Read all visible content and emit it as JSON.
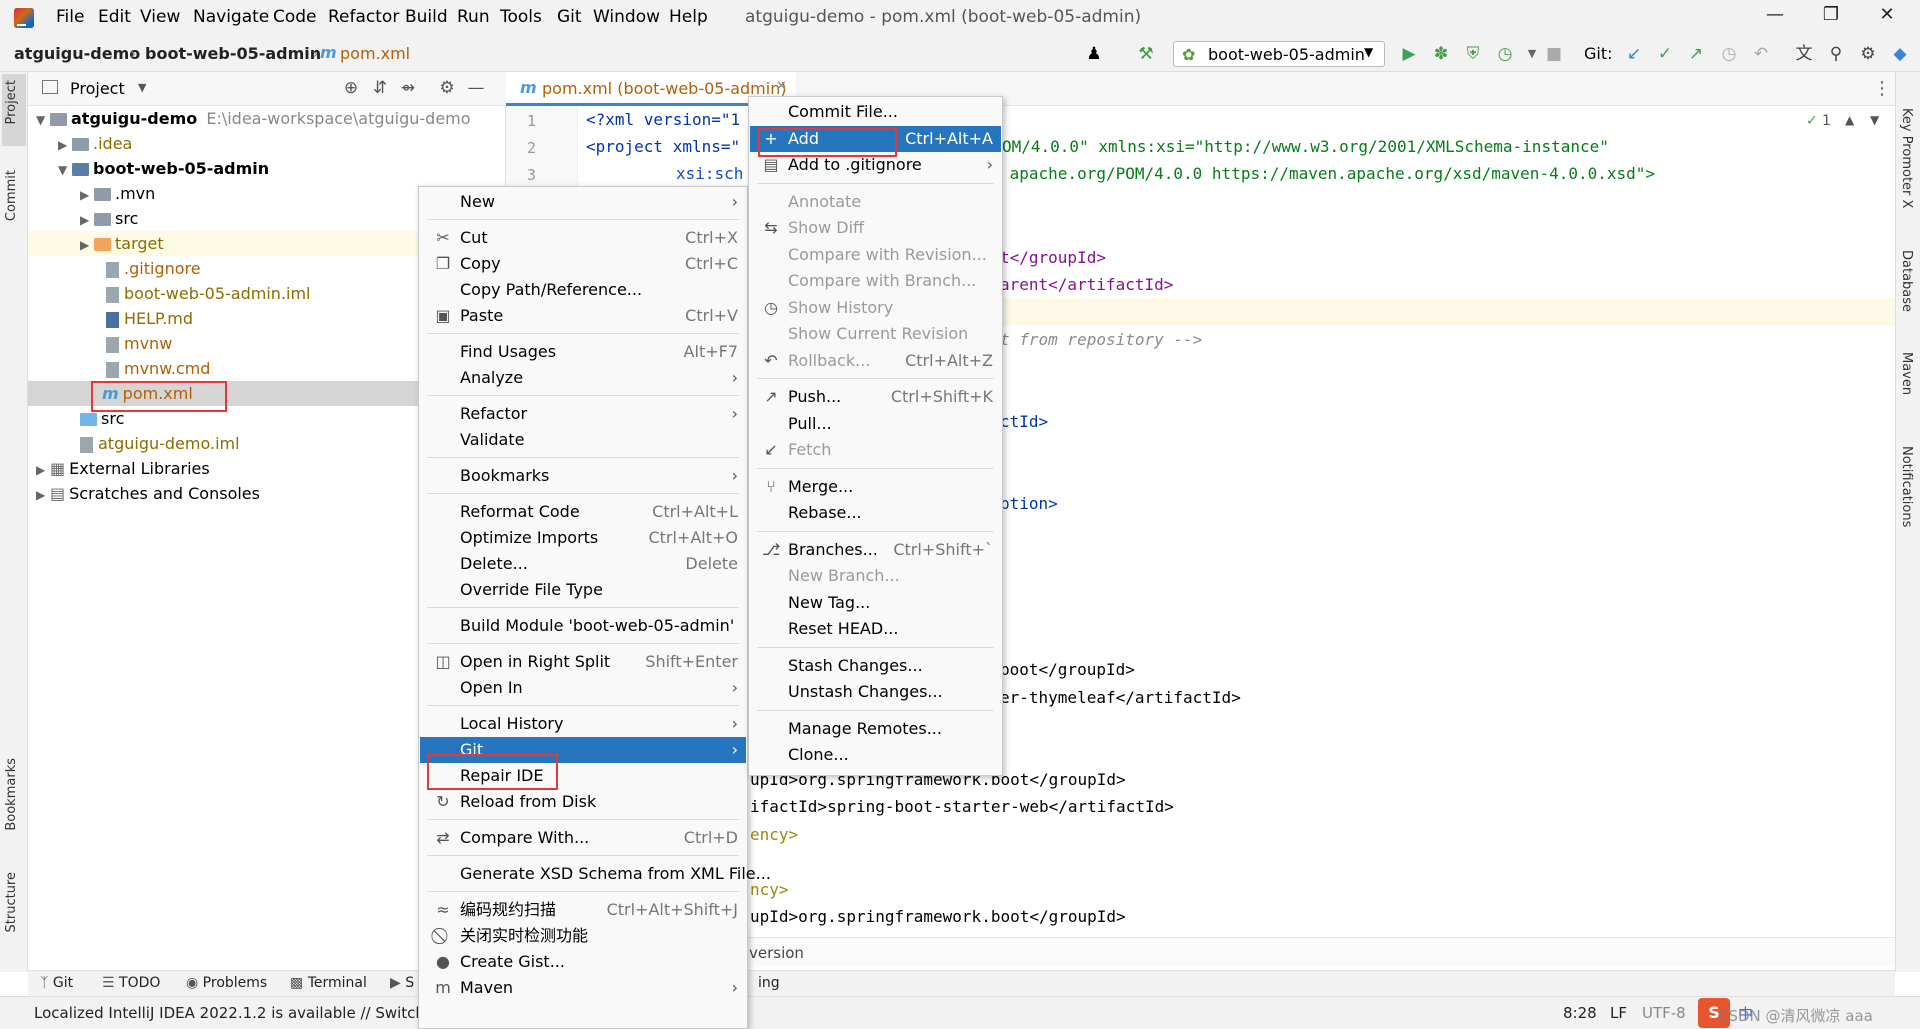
{
  "window": {
    "title": "atguigu-demo - pom.xml (boot-web-05-admin)",
    "menus": [
      "File",
      "Edit",
      "View",
      "Navigate",
      "Code",
      "Refactor",
      "Build",
      "Run",
      "Tools",
      "Git",
      "Window",
      "Help"
    ]
  },
  "breadcrumb": {
    "project": "atguigu-demo",
    "module": "boot-web-05-admin",
    "file": "pom.xml"
  },
  "toolbar": {
    "run_config": "boot-web-05-admin",
    "git_label": "Git:"
  },
  "project_panel": {
    "title": "Project",
    "root": "atguigu-demo",
    "root_path": "E:\\idea-workspace\\atguigu-demo",
    "items": [
      ".idea",
      "boot-web-05-admin",
      ".mvn",
      "src",
      "target",
      ".gitignore",
      "boot-web-05-admin.iml",
      "HELP.md",
      "mvnw",
      "mvnw.cmd",
      "pom.xml",
      "src",
      "atguigu-demo.iml",
      "External Libraries",
      "Scratches and Consoles"
    ]
  },
  "editor": {
    "tab": "pom.xml (boot-web-05-admin)",
    "line_numbers": [
      "1",
      "2",
      "3"
    ],
    "lines": [
      "<?xml version=\"1",
      "<project xmlns=\"",
      "xsi:sch",
      "OM/4.0.0\" xmlns:xsi=\"http://www.w3.org/2001/XMLSchema-instance\"",
      " apache.org/POM/4.0.0 https://maven.apache.org/xsd/maven-4.0.0.xsd\">",
      "t</groupId>",
      "arent</artifactId>",
      "t from repository -->",
      "ctId>",
      "ption>",
      "boot</groupId>",
      "er-thymeleaf</artifactId>",
      "upId>org.springframework.boot</groupId>",
      "ifactId>spring-boot-starter-web</artifactId>",
      "ency>",
      "ncy>",
      "upId>org.springframework.boot</groupId>"
    ],
    "inspection_count": "1"
  },
  "context_menu": [
    {
      "label": "New",
      "submenu": true
    },
    {
      "sep": true
    },
    {
      "label": "Cut",
      "shortcut": "Ctrl+X",
      "icon": "cut-icon"
    },
    {
      "label": "Copy",
      "shortcut": "Ctrl+C",
      "icon": "copy-icon"
    },
    {
      "label": "Copy Path/Reference..."
    },
    {
      "label": "Paste",
      "shortcut": "Ctrl+V",
      "icon": "paste-icon"
    },
    {
      "sep": true
    },
    {
      "label": "Find Usages",
      "shortcut": "Alt+F7"
    },
    {
      "label": "Analyze",
      "submenu": true
    },
    {
      "sep": true
    },
    {
      "label": "Refactor",
      "submenu": true
    },
    {
      "label": "Validate"
    },
    {
      "sep": true
    },
    {
      "label": "Bookmarks",
      "submenu": true
    },
    {
      "sep": true
    },
    {
      "label": "Reformat Code",
      "shortcut": "Ctrl+Alt+L"
    },
    {
      "label": "Optimize Imports",
      "shortcut": "Ctrl+Alt+O"
    },
    {
      "label": "Delete...",
      "shortcut": "Delete"
    },
    {
      "label": "Override File Type"
    },
    {
      "sep": true
    },
    {
      "label": "Build Module 'boot-web-05-admin'"
    },
    {
      "sep": true
    },
    {
      "label": "Open in Right Split",
      "shortcut": "Shift+Enter",
      "icon": "split-icon"
    },
    {
      "label": "Open In",
      "submenu": true
    },
    {
      "sep": true
    },
    {
      "label": "Local History",
      "submenu": true
    },
    {
      "label": "Git",
      "submenu": true,
      "selected": true
    },
    {
      "label": "Repair IDE"
    },
    {
      "label": "Reload from Disk",
      "icon": "reload-icon"
    },
    {
      "sep": true
    },
    {
      "label": "Compare With...",
      "shortcut": "Ctrl+D",
      "icon": "compare-icon"
    },
    {
      "sep": true
    },
    {
      "label": "Generate XSD Schema from XML File..."
    },
    {
      "sep": true
    },
    {
      "label": "编码规约扫描",
      "shortcut": "Ctrl+Alt+Shift+J",
      "icon": "scan-icon"
    },
    {
      "label": "关闭实时检测功能",
      "icon": "disable-icon"
    },
    {
      "label": "Create Gist...",
      "icon": "github-icon"
    },
    {
      "label": "Maven",
      "submenu": true,
      "icon": "maven-icon"
    }
  ],
  "git_menu": [
    {
      "label": "Commit File..."
    },
    {
      "label": "Add",
      "shortcut": "Ctrl+Alt+A",
      "selected": true,
      "icon": "plus-icon"
    },
    {
      "label": "Add to .gitignore",
      "submenu": true,
      "icon": "gitignore-icon"
    },
    {
      "sep": true
    },
    {
      "label": "Annotate",
      "disabled": true
    },
    {
      "label": "Show Diff",
      "disabled": true,
      "icon": "diff-icon"
    },
    {
      "label": "Compare with Revision...",
      "disabled": true
    },
    {
      "label": "Compare with Branch...",
      "disabled": true
    },
    {
      "label": "Show History",
      "disabled": true,
      "icon": "history-icon"
    },
    {
      "label": "Show Current Revision",
      "disabled": true
    },
    {
      "label": "Rollback...",
      "shortcut": "Ctrl+Alt+Z",
      "disabled": true,
      "icon": "rollback-icon"
    },
    {
      "sep": true
    },
    {
      "label": "Push...",
      "shortcut": "Ctrl+Shift+K",
      "icon": "push-icon"
    },
    {
      "label": "Pull..."
    },
    {
      "label": "Fetch",
      "disabled": true,
      "icon": "fetch-icon"
    },
    {
      "sep": true
    },
    {
      "label": "Merge...",
      "icon": "merge-icon"
    },
    {
      "label": "Rebase..."
    },
    {
      "sep": true
    },
    {
      "label": "Branches...",
      "shortcut": "Ctrl+Shift+`",
      "icon": "branch-icon"
    },
    {
      "label": "New Branch...",
      "disabled": true
    },
    {
      "label": "New Tag..."
    },
    {
      "label": "Reset HEAD..."
    },
    {
      "sep": true
    },
    {
      "label": "Stash Changes..."
    },
    {
      "label": "Unstash Changes..."
    },
    {
      "sep": true
    },
    {
      "label": "Manage Remotes..."
    },
    {
      "label": "Clone..."
    }
  ],
  "bottom_tabs": [
    "Git",
    "TODO",
    "Problems",
    "Terminal",
    "S"
  ],
  "left_strip": [
    "Project",
    "Commit",
    "Bookmarks",
    "Structure"
  ],
  "right_strip": [
    "Key Promoter X",
    "Database",
    "Maven",
    "Notifications"
  ],
  "status": {
    "message": "Localized IntelliJ IDEA 2022.1.2 is available // Switch a",
    "position": "8:28",
    "line_sep": "LF",
    "encoding": "UTF-8",
    "partial_ing": "ing",
    "partial_version": "version",
    "watermark": "CSDN @清风微凉 aaa"
  }
}
